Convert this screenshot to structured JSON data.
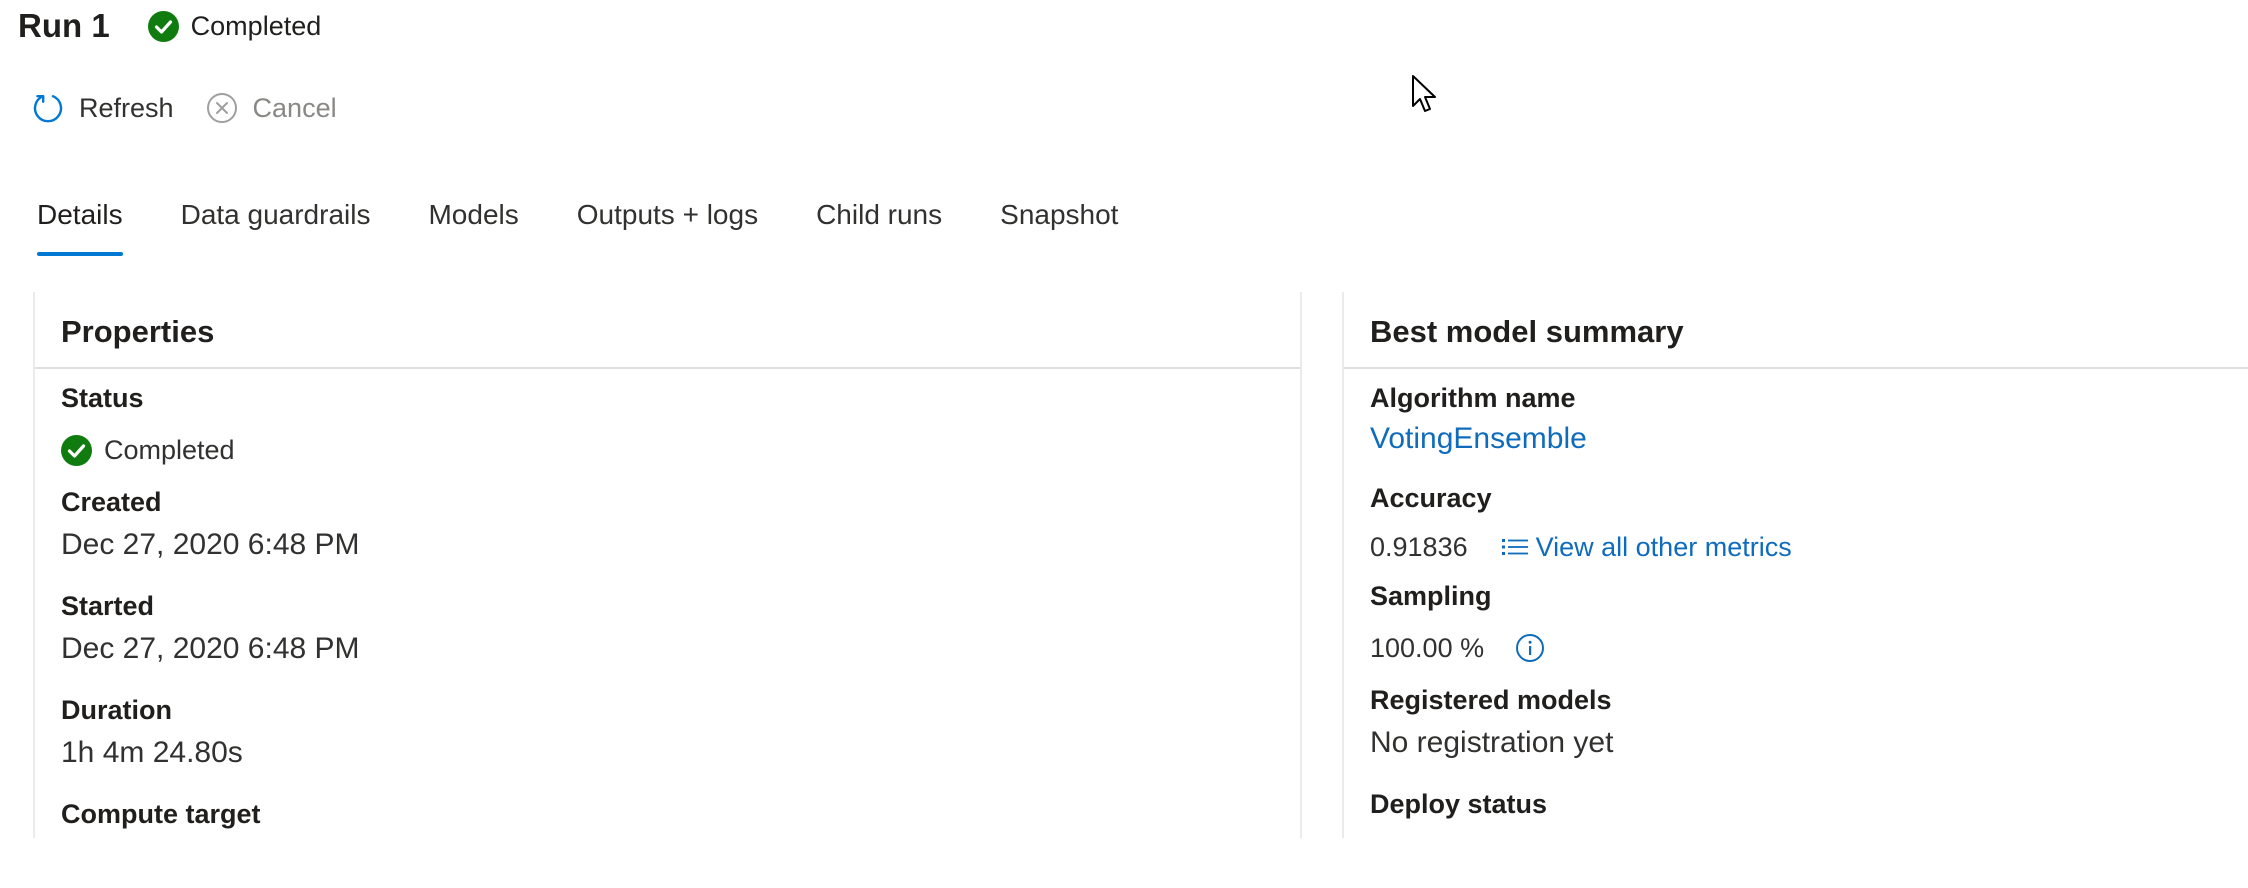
{
  "header": {
    "title": "Run 1",
    "status": "Completed"
  },
  "toolbar": {
    "refresh_label": "Refresh",
    "cancel_label": "Cancel"
  },
  "tabs": [
    {
      "label": "Details",
      "active": true
    },
    {
      "label": "Data guardrails"
    },
    {
      "label": "Models"
    },
    {
      "label": "Outputs + logs"
    },
    {
      "label": "Child runs"
    },
    {
      "label": "Snapshot"
    }
  ],
  "properties": {
    "title": "Properties",
    "status_label": "Status",
    "status_value": "Completed",
    "created_label": "Created",
    "created_value": "Dec 27, 2020 6:48 PM",
    "started_label": "Started",
    "started_value": "Dec 27, 2020 6:48 PM",
    "duration_label": "Duration",
    "duration_value": "1h 4m 24.80s",
    "compute_label": "Compute target"
  },
  "best_model": {
    "title": "Best model summary",
    "algorithm_label": "Algorithm name",
    "algorithm_value": "VotingEnsemble",
    "accuracy_label": "Accuracy",
    "accuracy_value": "0.91836",
    "metrics_link": "View all other metrics",
    "sampling_label": "Sampling",
    "sampling_value": "100.00 %",
    "registered_label": "Registered models",
    "registered_value": "No registration yet",
    "deploy_label": "Deploy status"
  },
  "icons": {
    "status": "check-circle-icon",
    "refresh": "refresh-icon",
    "cancel": "cancel-circle-icon",
    "metrics": "list-icon",
    "info": "info-icon",
    "pointer": "mouse-cursor-icon"
  },
  "colors": {
    "success": "#107c10",
    "accent": "#0078d4",
    "link": "#0f6cbd"
  }
}
